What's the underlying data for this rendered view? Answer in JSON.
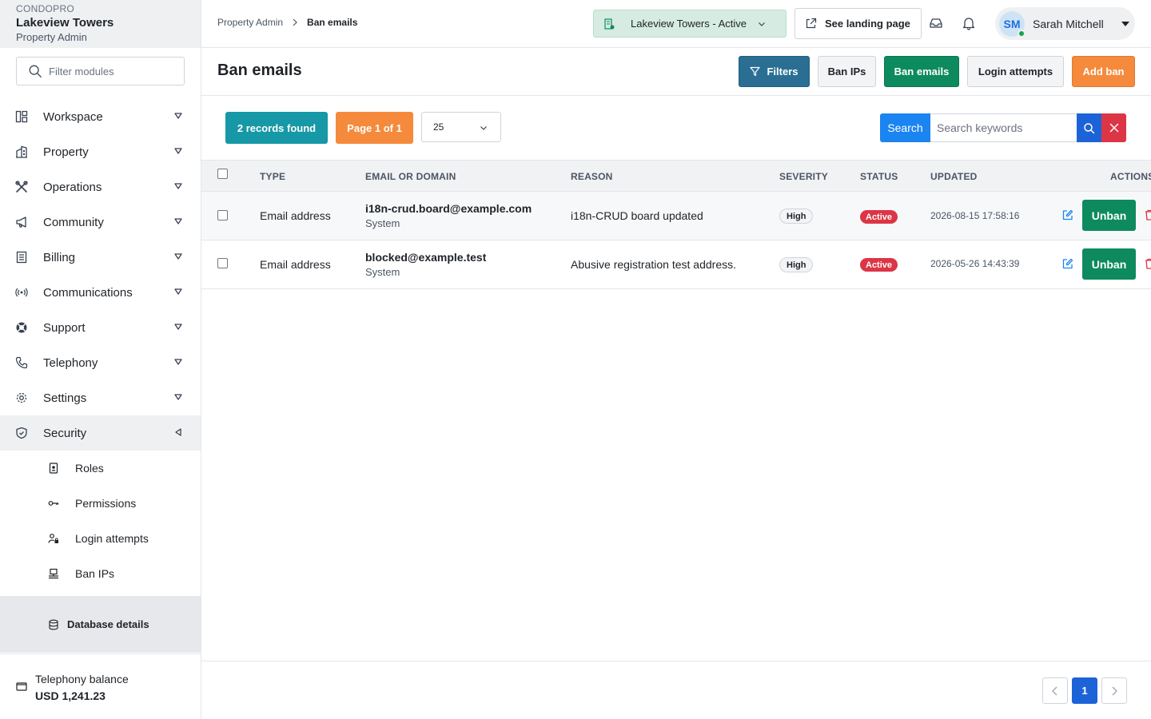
{
  "brand": {
    "kicker": "CONDOPRO",
    "name": "Lakeview Towers",
    "role": "Property Admin"
  },
  "sidebar": {
    "filter_placeholder": "Filter modules",
    "items": [
      {
        "label": "Workspace",
        "icon": "workspace-icon"
      },
      {
        "label": "Property",
        "icon": "building-icon"
      },
      {
        "label": "Operations",
        "icon": "tools-icon"
      },
      {
        "label": "Community",
        "icon": "megaphone-icon"
      },
      {
        "label": "Billing",
        "icon": "receipt-icon"
      },
      {
        "label": "Communications",
        "icon": "broadcast-icon"
      },
      {
        "label": "Support",
        "icon": "lifebuoy-icon"
      },
      {
        "label": "Telephony",
        "icon": "phone-icon"
      },
      {
        "label": "Settings",
        "icon": "gear-icon"
      },
      {
        "label": "Security",
        "icon": "shield-icon"
      }
    ],
    "security_sub": [
      {
        "label": "Roles",
        "icon": "id-badge-icon"
      },
      {
        "label": "Permissions",
        "icon": "key-icon"
      },
      {
        "label": "Login attempts",
        "icon": "user-lock-icon"
      },
      {
        "label": "Ban IPs",
        "icon": "network-icon"
      }
    ],
    "database_details": "Database details",
    "balance_label": "Telephony balance",
    "balance_value": "USD 1,241.23"
  },
  "topbar": {
    "breadcrumb_parent": "Property Admin",
    "breadcrumb_current": "Ban emails",
    "property_select": "Lakeview Towers - Active",
    "landing_button": "See landing page",
    "user_initials": "SM",
    "user_name": "Sarah Mitchell"
  },
  "page": {
    "title": "Ban emails",
    "buttons": {
      "filters": "Filters",
      "ban_ips": "Ban IPs",
      "ban_emails": "Ban emails",
      "login_attempts": "Login attempts",
      "add_ban": "Add ban"
    }
  },
  "toolbar": {
    "records": "2 records found",
    "page_info": "Page 1 of 1",
    "per_page": "25",
    "search_label": "Search",
    "search_placeholder": "Search keywords"
  },
  "table": {
    "headers": {
      "type": "TYPE",
      "email": "EMAIL OR DOMAIN",
      "reason": "REASON",
      "severity": "SEVERITY",
      "status": "STATUS",
      "updated": "UPDATED",
      "actions": "ACTIONS"
    },
    "rows": [
      {
        "type": "Email address",
        "email": "i18n-crud.board@example.com",
        "source": "System",
        "reason": "i18n-CRUD board updated",
        "severity": "High",
        "status": "Active",
        "updated": "2026-08-15 17:58:16",
        "action": "Unban"
      },
      {
        "type": "Email address",
        "email": "blocked@example.test",
        "source": "System",
        "reason": "Abusive registration test address.",
        "severity": "High",
        "status": "Active",
        "updated": "2026-05-26 14:43:39",
        "action": "Unban"
      }
    ]
  },
  "pagination": {
    "current": "1"
  },
  "colors": {
    "primary": "#1d63d8",
    "success": "#0e8a5f",
    "warning": "#f58a3c",
    "danger": "#dc3545",
    "info": "#1698a6",
    "filters": "#2a6f93"
  }
}
